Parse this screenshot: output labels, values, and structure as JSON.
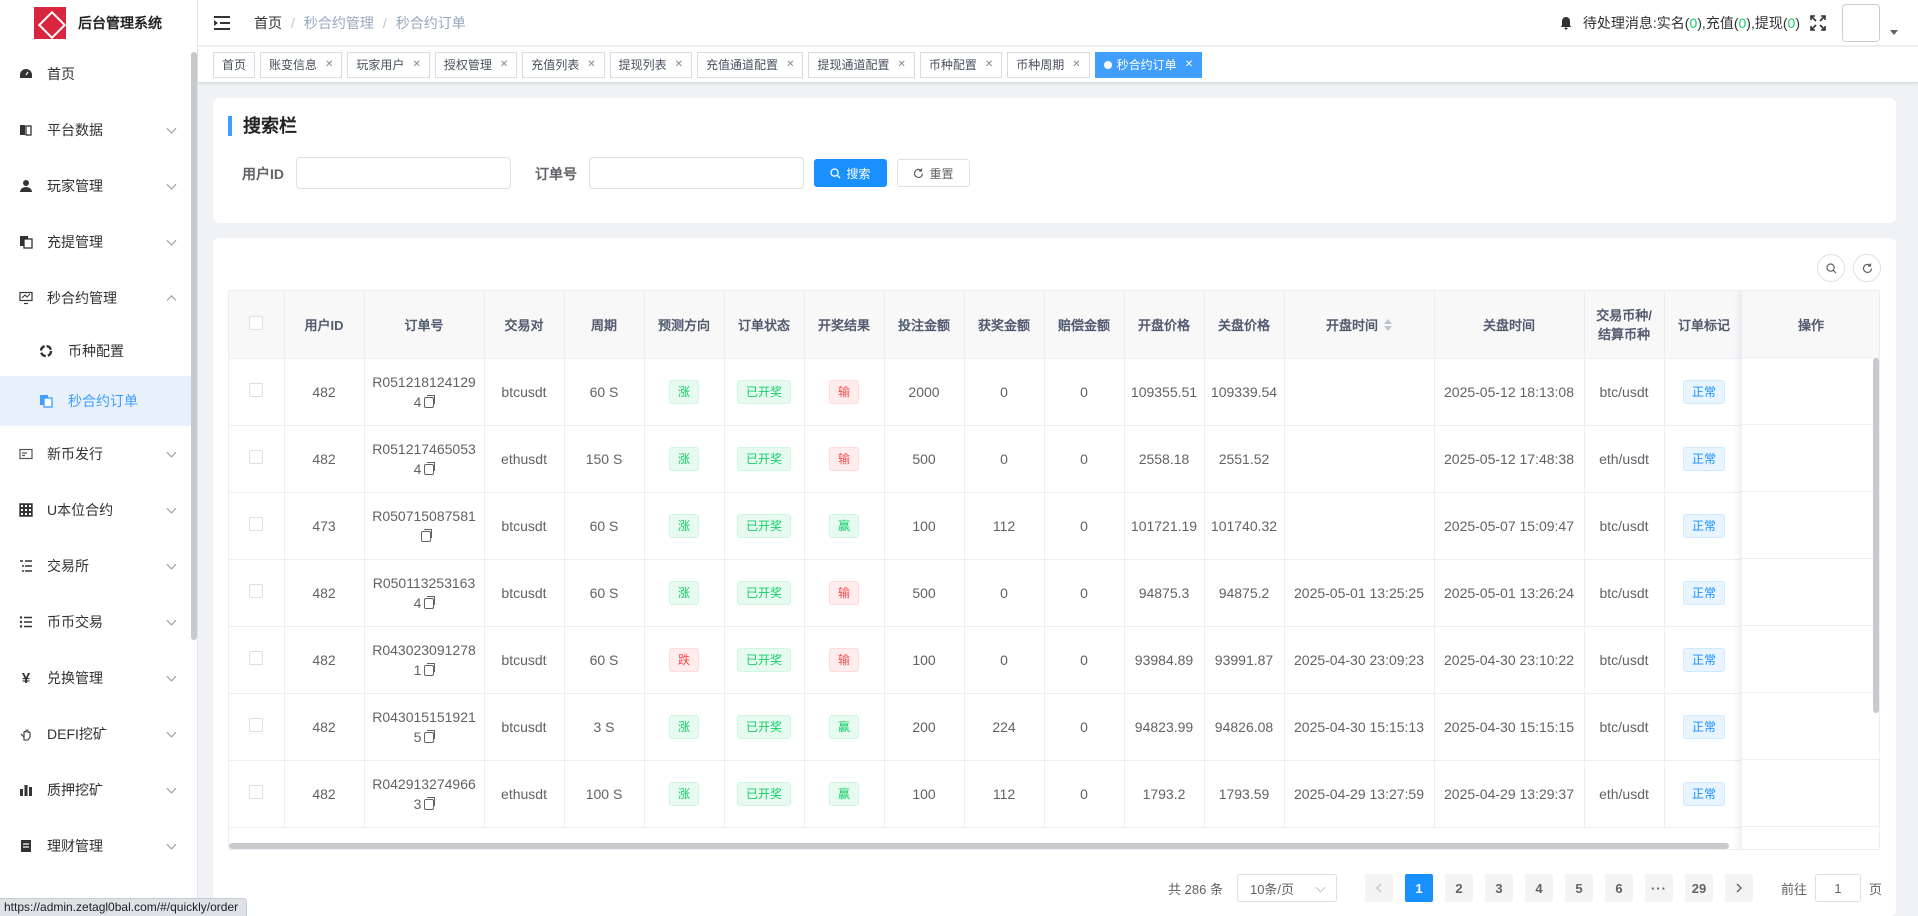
{
  "app": {
    "title": "后台管理系统"
  },
  "sidebar": {
    "items": [
      {
        "label": "首页",
        "icon": "dashboard-icon",
        "expandable": false
      },
      {
        "label": "平台数据",
        "icon": "book-icon",
        "expandable": true
      },
      {
        "label": "玩家管理",
        "icon": "user-icon",
        "expandable": true
      },
      {
        "label": "充提管理",
        "icon": "copy-document-icon",
        "expandable": true
      },
      {
        "label": "秒合约管理",
        "icon": "monitor-icon",
        "expandable": true,
        "expanded": true,
        "children": [
          {
            "label": "币种配置",
            "icon": "coin-icon"
          },
          {
            "label": "秒合约订单",
            "icon": "document-icon",
            "active": true
          }
        ]
      },
      {
        "label": "新币发行",
        "icon": "card-icon",
        "expandable": true
      },
      {
        "label": "U本位合约",
        "icon": "grid-icon",
        "expandable": true
      },
      {
        "label": "交易所",
        "icon": "list-icon",
        "expandable": true
      },
      {
        "label": "币币交易",
        "icon": "list-bullets-icon",
        "expandable": true
      },
      {
        "label": "兑换管理",
        "icon": "yen-icon",
        "expandable": true
      },
      {
        "label": "DEFI挖矿",
        "icon": "hand-icon",
        "expandable": true
      },
      {
        "label": "质押挖矿",
        "icon": "bar-chart-icon",
        "expandable": true
      },
      {
        "label": "理财管理",
        "icon": "wallet-icon",
        "expandable": true
      }
    ]
  },
  "header": {
    "breadcrumb": [
      "首页",
      "秒合约管理",
      "秒合约订单"
    ],
    "notice_label": "待处理消息:",
    "notices": [
      {
        "label": "实名",
        "count": "0"
      },
      {
        "label": "充值",
        "count": "0"
      },
      {
        "label": "提现",
        "count": "0"
      }
    ]
  },
  "tags": [
    {
      "label": "首页",
      "closable": false
    },
    {
      "label": "账变信息",
      "closable": true
    },
    {
      "label": "玩家用户",
      "closable": true
    },
    {
      "label": "授权管理",
      "closable": true
    },
    {
      "label": "充值列表",
      "closable": true
    },
    {
      "label": "提现列表",
      "closable": true
    },
    {
      "label": "充值通道配置",
      "closable": true
    },
    {
      "label": "提现通道配置",
      "closable": true
    },
    {
      "label": "币种配置",
      "closable": true
    },
    {
      "label": "币种周期",
      "closable": true
    },
    {
      "label": "秒合约订单",
      "closable": true,
      "active": true
    }
  ],
  "search": {
    "title": "搜索栏",
    "user_id_label": "用户ID",
    "user_id_value": "",
    "order_no_label": "订单号",
    "order_no_value": "",
    "search_label": "搜索",
    "reset_label": "重置"
  },
  "table": {
    "columns": [
      "",
      "用户ID",
      "订单号",
      "交易对",
      "周期",
      "预测方向",
      "订单状态",
      "开奖结果",
      "投注金额",
      "获奖金额",
      "赔偿金额",
      "开盘价格",
      "关盘价格",
      "开盘时间",
      "关盘时间",
      "交易币种/结算币种",
      "订单标记"
    ],
    "action_column": "操作",
    "rows": [
      {
        "user_id": "482",
        "order_no": "R0512181241294",
        "pair": "btcusdt",
        "period": "60 S",
        "direction": "涨",
        "status": "已开奖",
        "result": "输",
        "bet": "2000",
        "win": "0",
        "comp": "0",
        "open_price": "109355.51",
        "close_price": "109339.54",
        "open_time": "",
        "close_time": "2025-05-12 18:13:08",
        "coins": "btc/usdt",
        "mark": "正常"
      },
      {
        "user_id": "482",
        "order_no": "R0512174650534",
        "pair": "ethusdt",
        "period": "150 S",
        "direction": "涨",
        "status": "已开奖",
        "result": "输",
        "bet": "500",
        "win": "0",
        "comp": "0",
        "open_price": "2558.18",
        "close_price": "2551.52",
        "open_time": "",
        "close_time": "2025-05-12 17:48:38",
        "coins": "eth/usdt",
        "mark": "正常"
      },
      {
        "user_id": "473",
        "order_no": "R050715087581",
        "pair": "btcusdt",
        "period": "60 S",
        "direction": "涨",
        "status": "已开奖",
        "result": "赢",
        "bet": "100",
        "win": "112",
        "comp": "0",
        "open_price": "101721.19",
        "close_price": "101740.32",
        "open_time": "",
        "close_time": "2025-05-07 15:09:47",
        "coins": "btc/usdt",
        "mark": "正常"
      },
      {
        "user_id": "482",
        "order_no": "R0501132531634",
        "pair": "btcusdt",
        "period": "60 S",
        "direction": "涨",
        "status": "已开奖",
        "result": "输",
        "bet": "500",
        "win": "0",
        "comp": "0",
        "open_price": "94875.3",
        "close_price": "94875.2",
        "open_time": "2025-05-01 13:25:25",
        "close_time": "2025-05-01 13:26:24",
        "coins": "btc/usdt",
        "mark": "正常"
      },
      {
        "user_id": "482",
        "order_no": "R0430230912781",
        "pair": "btcusdt",
        "period": "60 S",
        "direction": "跌",
        "status": "已开奖",
        "result": "输",
        "bet": "100",
        "win": "0",
        "comp": "0",
        "open_price": "93984.89",
        "close_price": "93991.87",
        "open_time": "2025-04-30 23:09:23",
        "close_time": "2025-04-30 23:10:22",
        "coins": "btc/usdt",
        "mark": "正常"
      },
      {
        "user_id": "482",
        "order_no": "R0430151519215",
        "pair": "btcusdt",
        "period": "3 S",
        "direction": "涨",
        "status": "已开奖",
        "result": "赢",
        "bet": "200",
        "win": "224",
        "comp": "0",
        "open_price": "94823.99",
        "close_price": "94826.08",
        "open_time": "2025-04-30 15:15:13",
        "close_time": "2025-04-30 15:15:15",
        "coins": "btc/usdt",
        "mark": "正常"
      },
      {
        "user_id": "482",
        "order_no": "R0429132749663",
        "pair": "ethusdt",
        "period": "100 S",
        "direction": "涨",
        "status": "已开奖",
        "result": "赢",
        "bet": "100",
        "win": "112",
        "comp": "0",
        "open_price": "1793.2",
        "close_price": "1793.59",
        "open_time": "2025-04-29 13:27:59",
        "close_time": "2025-04-29 13:29:37",
        "coins": "eth/usdt",
        "mark": "正常"
      }
    ]
  },
  "pagination": {
    "total_text": "共 286 条",
    "page_size": "10条/页",
    "pages": [
      "1",
      "2",
      "3",
      "4",
      "5",
      "6",
      "···",
      "29"
    ],
    "current": "1",
    "goto_label": "前往",
    "goto_value": "1",
    "page_suffix": "页"
  },
  "status_bar": {
    "url": "https://admin.zetagl0bal.com/#/quickly/order"
  },
  "colors": {
    "primary": "#1890ff",
    "success": "#13ce66",
    "danger": "#ff4949",
    "logo": "#d7263d"
  }
}
